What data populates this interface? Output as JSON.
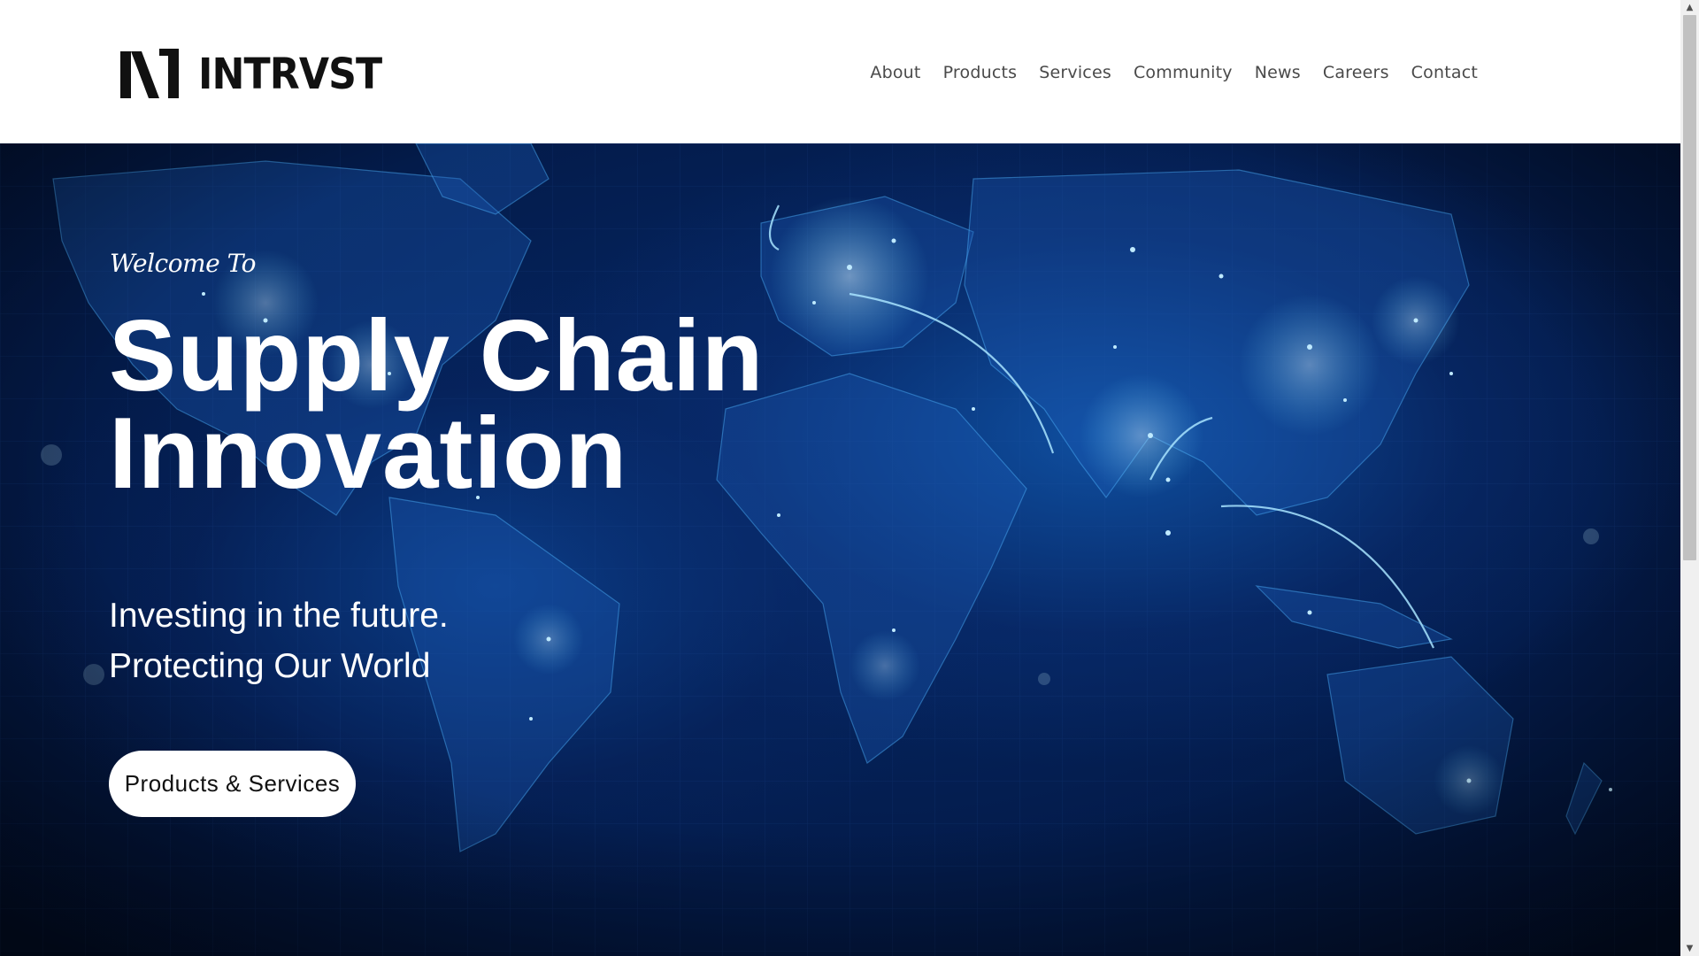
{
  "header": {
    "brand": "INTRVST",
    "nav": [
      "About",
      "Products",
      "Services",
      "Community",
      "News",
      "Careers",
      "Contact"
    ]
  },
  "hero": {
    "welcome": "Welcome To",
    "title_line1": "Supply Chain",
    "title_line2": "Innovation",
    "tagline_line1": "Investing in the future.",
    "tagline_line2": "Protecting Our World",
    "cta_label": "Products & Services",
    "background_icon": "world-map-network-icon"
  },
  "colors": {
    "hero_deep": "#020f2c",
    "hero_mid": "#062a6b",
    "glow": "#5fd4ff",
    "text_white": "#ffffff",
    "nav_text": "#4a4a4a"
  },
  "scrollbar": {
    "up_icon": "scroll-up-arrow-icon",
    "down_icon": "scroll-down-arrow-icon"
  }
}
